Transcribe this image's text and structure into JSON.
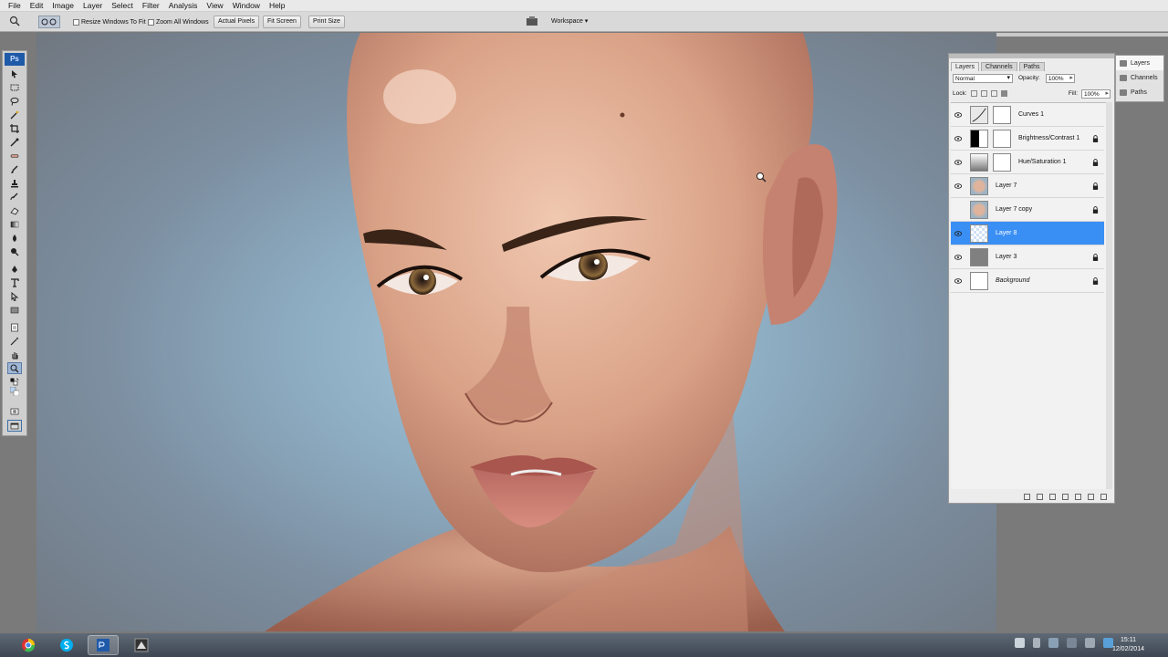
{
  "menu": [
    "File",
    "Edit",
    "Image",
    "Layer",
    "Select",
    "Filter",
    "Analysis",
    "View",
    "Window",
    "Help"
  ],
  "options_bar": {
    "resize_windows": "Resize Windows To Fit",
    "zoom_all_windows": "Zoom All Windows",
    "actual_pixels": "Actual Pixels",
    "fit_screen": "Fit Screen",
    "print_size": "Print Size",
    "workspace": "Workspace ▾"
  },
  "toolbox": {
    "badge": "Ps"
  },
  "layers_panel": {
    "tabs": [
      "Layers",
      "Channels",
      "Paths"
    ],
    "blend_mode": "Normal",
    "opacity_label": "Opacity:",
    "opacity_value": "100%",
    "lock_label": "Lock:",
    "fill_label": "Fill:",
    "fill_value": "100%",
    "layers": [
      {
        "name": "Curves 1",
        "visible": true,
        "locked": false,
        "selected": false,
        "italic": false
      },
      {
        "name": "Brightness/Contrast 1",
        "visible": true,
        "locked": true,
        "selected": false,
        "italic": false
      },
      {
        "name": "Hue/Saturation 1",
        "visible": true,
        "locked": true,
        "selected": false,
        "italic": false
      },
      {
        "name": "Layer 7",
        "visible": true,
        "locked": true,
        "selected": false,
        "italic": false
      },
      {
        "name": "Layer 7 copy",
        "visible": false,
        "locked": true,
        "selected": false,
        "italic": false
      },
      {
        "name": "Layer 8",
        "visible": true,
        "locked": false,
        "selected": true,
        "italic": false
      },
      {
        "name": "Layer 3",
        "visible": true,
        "locked": true,
        "selected": false,
        "italic": false
      },
      {
        "name": "Background",
        "visible": true,
        "locked": true,
        "selected": false,
        "italic": true
      }
    ]
  },
  "dock": [
    "Layers",
    "Channels",
    "Paths"
  ],
  "taskbar": {
    "time": "15:11",
    "date": "12/02/2014"
  },
  "colors": {
    "selection": "#3a8ff5",
    "ps_blue": "#1f5aa8",
    "canvas_bg": "#8eaec4"
  }
}
